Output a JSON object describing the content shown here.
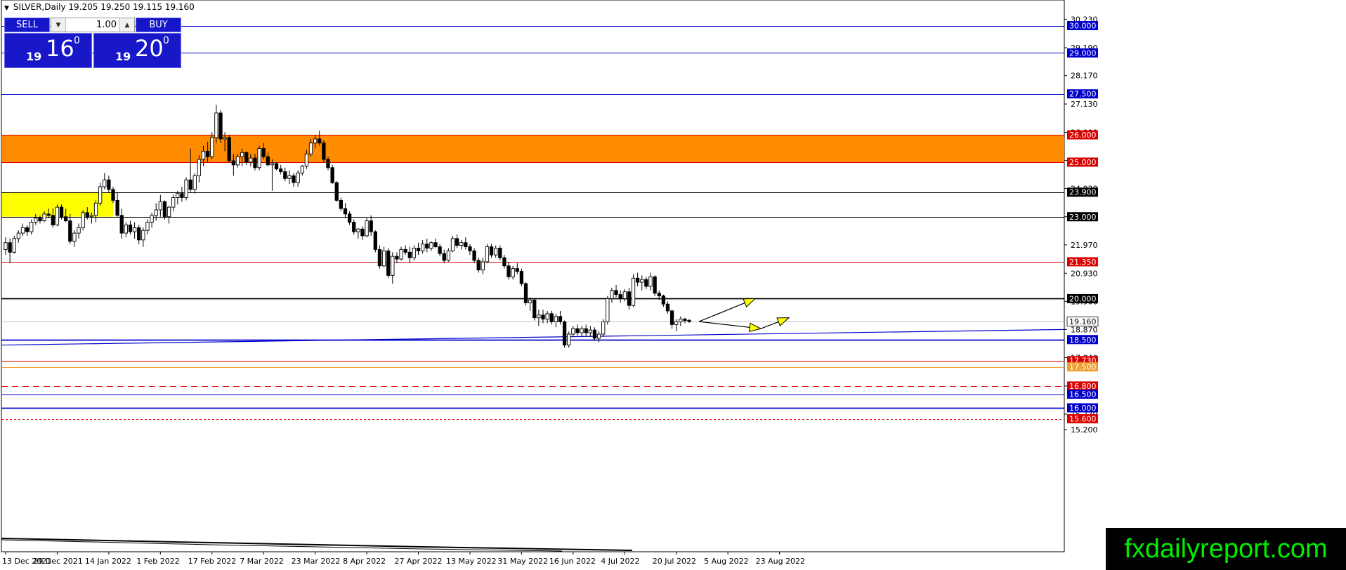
{
  "header": {
    "symbol": "SILVER,Daily",
    "ohlc": "19.205 19.250 19.115 19.160"
  },
  "trade_panel": {
    "sell_label": "SELL",
    "buy_label": "BUY",
    "lot_value": "1.00",
    "sell_price": {
      "small": "19",
      "big": "16",
      "sup": "0"
    },
    "buy_price": {
      "small": "19",
      "big": "20",
      "sup": "0"
    }
  },
  "watermark": "fxdailyreport.com",
  "chart_data": {
    "type": "candlestick",
    "symbol": "SILVER",
    "timeframe": "Daily",
    "ylim": [
      15.2,
      30.75
    ],
    "y_ticks": [
      30.23,
      29.19,
      28.17,
      27.13,
      26.09,
      25.06,
      24.03,
      23.0,
      21.97,
      20.93,
      19.9,
      18.87,
      17.84,
      16.8,
      15.77,
      15.2
    ],
    "x_labels": [
      "13 Dec 2021",
      "29 Dec 2021",
      "14 Jan 2022",
      "1 Feb 2022",
      "17 Feb 2022",
      "7 Mar 2022",
      "23 Mar 2022",
      "8 Apr 2022",
      "27 Apr 2022",
      "13 May 2022",
      "31 May 2022",
      "16 Jun 2022",
      "4 Jul 2022",
      "20 Jul 2022",
      "5 Aug 2022",
      "23 Aug 2022"
    ],
    "current_price": 19.16,
    "levels": [
      {
        "price": 30.0,
        "label": "30.000",
        "color": "#0000cc",
        "style": "solid"
      },
      {
        "price": 29.0,
        "label": "29.000",
        "color": "#0000cc",
        "style": "solid"
      },
      {
        "price": 27.5,
        "label": "27.500",
        "color": "#0000cc",
        "style": "solid"
      },
      {
        "price": 26.0,
        "label": "26.000",
        "color": "#dd0000",
        "style": "solid"
      },
      {
        "price": 25.0,
        "label": "25.000",
        "color": "#dd0000",
        "style": "solid"
      },
      {
        "price": 23.9,
        "label": "23.900",
        "color": "#000000",
        "style": "solid"
      },
      {
        "price": 23.0,
        "label": "23.000",
        "color": "#000000",
        "style": "solid"
      },
      {
        "price": 21.35,
        "label": "21.350",
        "color": "#dd0000",
        "style": "solid"
      },
      {
        "price": 20.0,
        "label": "20.000",
        "color": "#000000",
        "style": "thick"
      },
      {
        "price": 18.5,
        "label": "18.500",
        "color": "#0000cc",
        "style": "thick"
      },
      {
        "price": 17.73,
        "label": "17.730",
        "color": "#dd0000",
        "style": "solid"
      },
      {
        "price": 17.5,
        "label": "17.500",
        "color": "#f0a030",
        "style": "solid"
      },
      {
        "price": 16.8,
        "label": "16.800",
        "color": "#dd0000",
        "style": "dashed"
      },
      {
        "price": 16.5,
        "label": "16.500",
        "color": "#0000cc",
        "style": "solid"
      },
      {
        "price": 16.0,
        "label": "16.000",
        "color": "#0000cc",
        "style": "thick"
      },
      {
        "price": 15.6,
        "label": "15.600",
        "color": "#dd0000",
        "style": "dotted"
      }
    ],
    "zones": [
      {
        "from": 25.0,
        "to": 26.0,
        "color": "#ff8c00"
      },
      {
        "from": 23.0,
        "to": 23.9,
        "color": "#ffff00",
        "until": "29 Dec 2021"
      }
    ],
    "candles": [
      [
        21.8,
        22.25,
        21.6,
        22.05
      ],
      [
        22.05,
        22.2,
        21.3,
        21.7
      ],
      [
        21.7,
        22.3,
        21.65,
        22.2
      ],
      [
        22.2,
        22.5,
        22.05,
        22.4
      ],
      [
        22.4,
        22.75,
        22.3,
        22.6
      ],
      [
        22.6,
        22.7,
        22.3,
        22.45
      ],
      [
        22.45,
        22.9,
        22.35,
        22.8
      ],
      [
        22.8,
        23.1,
        22.7,
        22.95
      ],
      [
        22.95,
        23.05,
        22.75,
        22.85
      ],
      [
        22.85,
        23.2,
        22.8,
        23.1
      ],
      [
        23.1,
        23.3,
        22.95,
        23.05
      ],
      [
        23.05,
        23.3,
        22.6,
        22.7
      ],
      [
        22.7,
        23.45,
        22.65,
        23.35
      ],
      [
        23.35,
        23.45,
        22.9,
        23.0
      ],
      [
        23.0,
        23.3,
        22.8,
        22.85
      ],
      [
        22.85,
        23.1,
        22.0,
        22.1
      ],
      [
        22.1,
        22.5,
        21.9,
        22.4
      ],
      [
        22.4,
        22.75,
        22.2,
        22.6
      ],
      [
        22.6,
        23.25,
        22.5,
        23.15
      ],
      [
        23.15,
        23.35,
        22.9,
        23.0
      ],
      [
        23.0,
        23.15,
        22.75,
        23.05
      ],
      [
        23.05,
        23.6,
        22.8,
        23.5
      ],
      [
        23.5,
        24.25,
        23.4,
        24.1
      ],
      [
        24.1,
        24.6,
        24.0,
        24.35
      ],
      [
        24.35,
        24.5,
        23.9,
        24.0
      ],
      [
        24.0,
        24.1,
        23.5,
        23.6
      ],
      [
        23.6,
        23.9,
        23.0,
        23.05
      ],
      [
        23.05,
        23.3,
        22.2,
        22.4
      ],
      [
        22.4,
        22.8,
        22.25,
        22.7
      ],
      [
        22.7,
        22.85,
        22.35,
        22.45
      ],
      [
        22.45,
        22.8,
        22.2,
        22.6
      ],
      [
        22.6,
        22.7,
        22.0,
        22.15
      ],
      [
        22.15,
        22.6,
        21.9,
        22.5
      ],
      [
        22.5,
        22.9,
        22.35,
        22.8
      ],
      [
        22.8,
        23.15,
        22.6,
        23.05
      ],
      [
        23.05,
        23.5,
        22.85,
        23.25
      ],
      [
        23.25,
        23.8,
        23.0,
        23.55
      ],
      [
        23.55,
        23.6,
        22.9,
        23.0
      ],
      [
        23.0,
        23.4,
        22.75,
        23.35
      ],
      [
        23.35,
        23.8,
        23.2,
        23.7
      ],
      [
        23.7,
        23.95,
        23.45,
        23.85
      ],
      [
        23.85,
        24.1,
        23.55,
        23.7
      ],
      [
        23.7,
        24.45,
        23.6,
        24.35
      ],
      [
        24.35,
        25.5,
        23.9,
        24.0
      ],
      [
        24.0,
        24.6,
        23.85,
        24.5
      ],
      [
        24.5,
        25.25,
        24.25,
        25.1
      ],
      [
        25.1,
        25.6,
        24.85,
        25.4
      ],
      [
        25.4,
        25.75,
        25.0,
        25.2
      ],
      [
        25.2,
        26.1,
        25.1,
        25.9
      ],
      [
        25.9,
        27.1,
        25.7,
        26.8
      ],
      [
        26.8,
        26.9,
        25.7,
        25.85
      ],
      [
        25.85,
        26.1,
        25.4,
        25.9
      ],
      [
        25.9,
        26.0,
        25.0,
        25.05
      ],
      [
        25.05,
        25.3,
        24.5,
        24.9
      ],
      [
        24.9,
        25.3,
        24.8,
        25.2
      ],
      [
        25.2,
        25.5,
        24.85,
        25.35
      ],
      [
        25.35,
        25.4,
        24.9,
        25.0
      ],
      [
        25.0,
        25.3,
        24.85,
        25.15
      ],
      [
        25.15,
        25.3,
        24.7,
        24.8
      ],
      [
        24.8,
        25.6,
        24.7,
        25.5
      ],
      [
        25.5,
        25.7,
        25.1,
        25.2
      ],
      [
        25.2,
        25.35,
        24.85,
        24.9
      ],
      [
        24.9,
        25.1,
        23.95,
        24.95
      ],
      [
        24.95,
        25.0,
        24.7,
        24.75
      ],
      [
        24.75,
        24.9,
        24.55,
        24.65
      ],
      [
        24.65,
        24.8,
        24.3,
        24.4
      ],
      [
        24.4,
        24.7,
        24.2,
        24.5
      ],
      [
        24.5,
        24.6,
        24.1,
        24.25
      ],
      [
        24.25,
        24.7,
        24.1,
        24.6
      ],
      [
        24.6,
        24.9,
        24.5,
        24.85
      ],
      [
        24.85,
        25.45,
        24.75,
        25.3
      ],
      [
        25.3,
        25.85,
        25.2,
        25.7
      ],
      [
        25.7,
        26.0,
        25.5,
        25.85
      ],
      [
        25.85,
        26.15,
        25.6,
        25.7
      ],
      [
        25.7,
        25.8,
        25.0,
        25.1
      ],
      [
        25.1,
        25.2,
        24.7,
        24.8
      ],
      [
        24.8,
        24.9,
        24.2,
        24.25
      ],
      [
        24.25,
        24.3,
        23.55,
        23.6
      ],
      [
        23.6,
        23.7,
        23.2,
        23.3
      ],
      [
        23.3,
        23.5,
        22.95,
        23.1
      ],
      [
        23.1,
        23.2,
        22.7,
        22.8
      ],
      [
        22.8,
        22.9,
        22.35,
        22.45
      ],
      [
        22.45,
        22.6,
        22.2,
        22.55
      ],
      [
        22.55,
        22.65,
        22.15,
        22.3
      ],
      [
        22.3,
        22.95,
        22.25,
        22.85
      ],
      [
        22.85,
        23.05,
        22.3,
        22.45
      ],
      [
        22.45,
        22.5,
        21.7,
        21.8
      ],
      [
        21.8,
        21.95,
        21.1,
        21.2
      ],
      [
        21.2,
        21.9,
        21.15,
        21.75
      ],
      [
        21.75,
        21.85,
        20.75,
        20.85
      ],
      [
        20.85,
        21.7,
        20.55,
        21.55
      ],
      [
        21.55,
        21.7,
        21.3,
        21.45
      ],
      [
        21.45,
        21.9,
        21.4,
        21.8
      ],
      [
        21.8,
        21.95,
        21.6,
        21.7
      ],
      [
        21.7,
        21.9,
        21.3,
        21.5
      ],
      [
        21.5,
        21.95,
        21.4,
        21.85
      ],
      [
        21.85,
        22.05,
        21.6,
        21.75
      ],
      [
        21.75,
        22.15,
        21.65,
        22.0
      ],
      [
        22.0,
        22.2,
        21.7,
        21.85
      ],
      [
        21.85,
        22.1,
        21.75,
        22.05
      ],
      [
        22.05,
        22.2,
        21.85,
        21.9
      ],
      [
        21.9,
        22.0,
        21.55,
        21.65
      ],
      [
        21.65,
        21.8,
        21.3,
        21.4
      ],
      [
        21.4,
        21.85,
        21.35,
        21.75
      ],
      [
        21.75,
        22.3,
        21.7,
        22.2
      ],
      [
        22.2,
        22.35,
        21.85,
        21.95
      ],
      [
        21.95,
        22.15,
        21.8,
        22.05
      ],
      [
        22.05,
        22.25,
        21.8,
        21.9
      ],
      [
        21.9,
        22.0,
        21.6,
        21.75
      ],
      [
        21.75,
        21.85,
        21.3,
        21.4
      ],
      [
        21.4,
        21.5,
        20.95,
        21.05
      ],
      [
        21.05,
        21.5,
        20.9,
        21.35
      ],
      [
        21.35,
        22.0,
        21.3,
        21.9
      ],
      [
        21.9,
        22.0,
        21.5,
        21.6
      ],
      [
        21.6,
        21.95,
        21.5,
        21.85
      ],
      [
        21.85,
        21.95,
        21.4,
        21.5
      ],
      [
        21.5,
        21.6,
        21.1,
        21.2
      ],
      [
        21.2,
        21.35,
        20.7,
        20.8
      ],
      [
        20.8,
        21.2,
        20.7,
        21.1
      ],
      [
        21.1,
        21.3,
        20.9,
        21.0
      ],
      [
        21.0,
        21.1,
        20.45,
        20.55
      ],
      [
        20.55,
        20.6,
        19.75,
        19.85
      ],
      [
        19.85,
        20.05,
        19.55,
        19.95
      ],
      [
        19.95,
        20.0,
        19.2,
        19.3
      ],
      [
        19.3,
        19.6,
        19.0,
        19.4
      ],
      [
        19.4,
        19.6,
        19.1,
        19.25
      ],
      [
        19.25,
        19.55,
        19.1,
        19.45
      ],
      [
        19.45,
        19.55,
        19.05,
        19.15
      ],
      [
        19.15,
        19.45,
        18.95,
        19.35
      ],
      [
        19.35,
        19.55,
        19.05,
        19.15
      ],
      [
        19.15,
        19.2,
        18.2,
        18.3
      ],
      [
        18.3,
        18.8,
        18.2,
        18.7
      ],
      [
        18.7,
        19.0,
        18.6,
        18.9
      ],
      [
        18.9,
        19.05,
        18.65,
        18.75
      ],
      [
        18.75,
        19.0,
        18.6,
        18.9
      ],
      [
        18.9,
        19.05,
        18.6,
        18.75
      ],
      [
        18.75,
        19.0,
        18.6,
        18.85
      ],
      [
        18.85,
        18.95,
        18.45,
        18.55
      ],
      [
        18.55,
        18.8,
        18.4,
        18.7
      ],
      [
        18.7,
        19.25,
        18.6,
        19.15
      ],
      [
        19.15,
        20.1,
        19.05,
        20.0
      ],
      [
        20.0,
        20.4,
        19.85,
        20.3
      ],
      [
        20.3,
        20.5,
        20.05,
        20.15
      ],
      [
        20.15,
        20.3,
        19.85,
        20.0
      ],
      [
        20.0,
        20.35,
        19.9,
        20.25
      ],
      [
        20.25,
        20.4,
        19.6,
        19.75
      ],
      [
        19.75,
        20.9,
        19.7,
        20.75
      ],
      [
        20.75,
        20.95,
        20.45,
        20.6
      ],
      [
        20.6,
        20.85,
        20.3,
        20.7
      ],
      [
        20.7,
        20.8,
        20.35,
        20.45
      ],
      [
        20.45,
        20.95,
        20.3,
        20.8
      ],
      [
        20.8,
        20.85,
        20.1,
        20.2
      ],
      [
        20.2,
        20.3,
        19.95,
        20.1
      ],
      [
        20.1,
        20.15,
        19.7,
        19.8
      ],
      [
        19.8,
        19.9,
        19.45,
        19.55
      ],
      [
        19.55,
        19.6,
        18.9,
        19.05
      ],
      [
        19.05,
        19.25,
        18.8,
        19.15
      ],
      [
        19.15,
        19.35,
        19.0,
        19.25
      ],
      [
        19.25,
        19.3,
        19.1,
        19.2
      ],
      [
        19.205,
        19.25,
        19.115,
        19.16
      ]
    ],
    "trendlines": [
      {
        "from": [
          "13 Dec 2021",
          18.3
        ],
        "to": [
          "23 Aug 2022",
          18.87
        ],
        "color": "#0000cc"
      }
    ],
    "annotations": [
      {
        "type": "arrow",
        "color": "#ffff00",
        "from": [
          "23 Aug 2022",
          19.16
        ],
        "to": [
          20.0
        ]
      },
      {
        "type": "arrow",
        "color": "#ffff00",
        "from": [
          "23 Aug 2022",
          19.16
        ],
        "to": [
          18.9
        ]
      },
      {
        "type": "arrow",
        "color": "#ffff00",
        "from": [
          18.9
        ],
        "to": [
          19.3
        ]
      }
    ]
  }
}
